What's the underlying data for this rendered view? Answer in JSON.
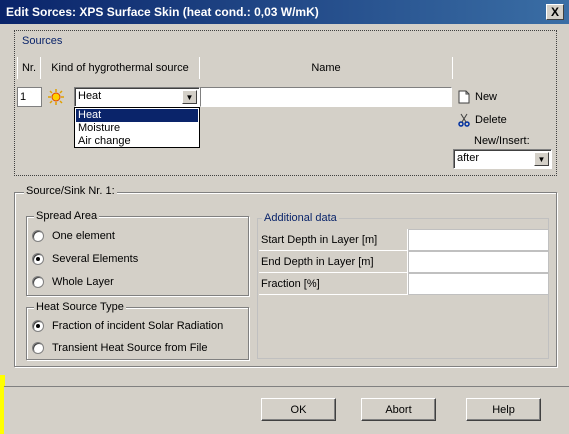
{
  "window": {
    "title": "Edit Sorces: XPS Surface Skin (heat cond.: 0,03 W/mK)",
    "close_label": "X"
  },
  "sources": {
    "legend": "Sources",
    "columns": {
      "nr": "Nr.",
      "kind": "Kind of hygrothermal source",
      "name": "Name"
    },
    "row": {
      "nr": "1",
      "icon": "sun-icon",
      "kind": "Heat",
      "name": ""
    },
    "dropdown": [
      "Heat",
      "Moisture",
      "Air change"
    ],
    "new_label": "New",
    "delete_label": "Delete",
    "new_insert_label": "New/Insert:",
    "new_insert_value": "after"
  },
  "source_sink": {
    "legend": "Source/Sink Nr. 1:",
    "spread_area": {
      "legend": "Spread Area",
      "options": [
        "One element",
        "Several Elements",
        "Whole Layer"
      ],
      "selected": "Several Elements"
    },
    "heat_source_type": {
      "legend": "Heat Source Type",
      "options": [
        "Fraction of incident Solar Radiation",
        "Transient Heat Source from File"
      ],
      "selected": "Fraction of incident Solar Radiation"
    },
    "additional_data": {
      "legend": "Additional data",
      "rows": [
        {
          "label": "Start Depth in Layer  [m]",
          "value": ""
        },
        {
          "label": "End Depth in Layer  [m]",
          "value": ""
        },
        {
          "label": "Fraction  [%]",
          "value": ""
        }
      ]
    }
  },
  "buttons": {
    "ok": "OK",
    "abort": "Abort",
    "help": "Help"
  },
  "colors": {
    "title_bar": "#0a246a",
    "dialog_bg": "#d4d0c8",
    "selection": "#0a246a",
    "legend_blue": "#0a246a"
  }
}
